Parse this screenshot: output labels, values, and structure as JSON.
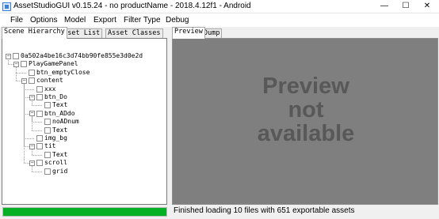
{
  "window": {
    "title": "AssetStudioGUI v0.15.24 - no productName - 2018.4.12f1 - Android",
    "minimize_glyph": "—",
    "maximize_glyph": "☐",
    "close_glyph": "✕"
  },
  "menu": [
    "File",
    "Options",
    "Model",
    "Export",
    "Filter Type",
    "Debug"
  ],
  "left_tabs": [
    "Scene Hierarchy",
    "Asset List",
    "Asset Classes"
  ],
  "left_active_tab": "Scene Hierarchy",
  "tree": [
    {
      "label": "0a502a4be16c3d74bb90fe855e3d0e2d",
      "level": 0,
      "expander": "minus"
    },
    {
      "label": "PlayGamePanel",
      "level": 1,
      "expander": "minus"
    },
    {
      "label": "btn_emptyClose",
      "level": 2,
      "expander": "none"
    },
    {
      "label": "content",
      "level": 2,
      "expander": "minus"
    },
    {
      "label": "xxx",
      "level": 3,
      "expander": "none"
    },
    {
      "label": "btn_Do",
      "level": 3,
      "expander": "minus"
    },
    {
      "label": "Text",
      "level": 4,
      "expander": "none"
    },
    {
      "label": "btn_ADdo",
      "level": 3,
      "expander": "minus"
    },
    {
      "label": "noADnum",
      "level": 4,
      "expander": "none"
    },
    {
      "label": "Text",
      "level": 4,
      "expander": "none"
    },
    {
      "label": "img_bg",
      "level": 3,
      "expander": "none"
    },
    {
      "label": "tit",
      "level": 3,
      "expander": "minus"
    },
    {
      "label": "Text",
      "level": 4,
      "expander": "none"
    },
    {
      "label": "scroll",
      "level": 3,
      "expander": "minus"
    },
    {
      "label": "grid",
      "level": 4,
      "expander": "none"
    }
  ],
  "right_tabs": [
    "Preview",
    "Dump"
  ],
  "right_active_tab": "Preview",
  "preview_lines": [
    "Preview",
    "not",
    "available"
  ],
  "status": {
    "progress_fraction": 1.0,
    "text": "Finished loading 10 files with 651 exportable assets"
  },
  "colors": {
    "progress_fill": "#06b025",
    "preview_bg": "#7f7f7f",
    "preview_text": "#585858"
  }
}
